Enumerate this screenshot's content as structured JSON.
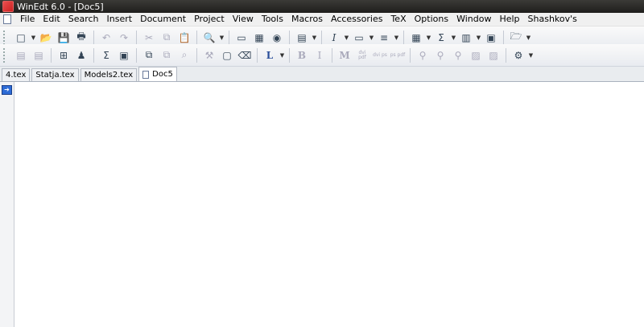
{
  "window": {
    "title": "WinEdt 6.0 - [Doc5]"
  },
  "menu": [
    "File",
    "Edit",
    "Search",
    "Insert",
    "Document",
    "Project",
    "View",
    "Tools",
    "Macros",
    "Accessories",
    "TeX",
    "Options",
    "Window",
    "Help",
    "Shashkov's"
  ],
  "toolbar1": {
    "buttons": [
      {
        "name": "new-file",
        "icon": "□"
      },
      {
        "name": "open-file",
        "icon": "📂"
      },
      {
        "name": "save",
        "icon": "💾"
      },
      {
        "name": "print",
        "icon": "🖶"
      },
      {
        "name": "undo",
        "icon": "↶"
      },
      {
        "name": "redo",
        "icon": "↷"
      },
      {
        "name": "cut",
        "icon": "✂"
      },
      {
        "name": "copy",
        "icon": "⧉"
      },
      {
        "name": "paste",
        "icon": "📋"
      },
      {
        "name": "find",
        "icon": "🔍"
      },
      {
        "name": "image",
        "icon": "▭"
      },
      {
        "name": "table",
        "icon": "▦"
      },
      {
        "name": "web",
        "icon": "◉"
      },
      {
        "name": "doc",
        "icon": "▤"
      },
      {
        "name": "italic",
        "icon": "I"
      },
      {
        "name": "frame",
        "icon": "▭"
      },
      {
        "name": "list",
        "icon": "≡"
      },
      {
        "name": "grid",
        "icon": "▦"
      },
      {
        "name": "sum",
        "icon": "Σ"
      },
      {
        "name": "book",
        "icon": "▥"
      },
      {
        "name": "page",
        "icon": "▣"
      },
      {
        "name": "folder",
        "icon": "🗁"
      }
    ]
  },
  "toolbar2": {
    "buttons": [
      {
        "name": "b1",
        "icon": "▤"
      },
      {
        "name": "b2",
        "icon": "▤"
      },
      {
        "name": "tree",
        "icon": "⊞"
      },
      {
        "name": "users",
        "icon": "♟"
      },
      {
        "name": "sigma",
        "icon": "Σ"
      },
      {
        "name": "monitor",
        "icon": "▣"
      },
      {
        "name": "copy2",
        "icon": "⧉"
      },
      {
        "name": "copy3",
        "icon": "⧉"
      },
      {
        "name": "search2",
        "icon": "⌕"
      },
      {
        "name": "tools",
        "icon": "⚒"
      },
      {
        "name": "window",
        "icon": "▢"
      },
      {
        "name": "trash",
        "icon": "⌫"
      },
      {
        "name": "l-style",
        "icon": "L"
      },
      {
        "name": "bold",
        "icon": "B"
      },
      {
        "name": "italic2",
        "icon": "I"
      },
      {
        "name": "m",
        "icon": "M"
      },
      {
        "name": "dvi-pdf",
        "icon": "dvi pdf"
      },
      {
        "name": "dvi-ps",
        "icon": "dvi ps"
      },
      {
        "name": "ps-pdf",
        "icon": "ps pdf"
      },
      {
        "name": "bw1",
        "icon": "⚲"
      },
      {
        "name": "bw2",
        "icon": "⚲"
      },
      {
        "name": "bw3",
        "icon": "⚲"
      },
      {
        "name": "img",
        "icon": "▨"
      },
      {
        "name": "pdf",
        "icon": "▨"
      },
      {
        "name": "pkg",
        "icon": "⚙"
      }
    ]
  },
  "tabs": [
    "4.tex",
    "Statja.tex",
    "Models2.tex",
    "Doc5"
  ],
  "active_tab": "Doc5"
}
